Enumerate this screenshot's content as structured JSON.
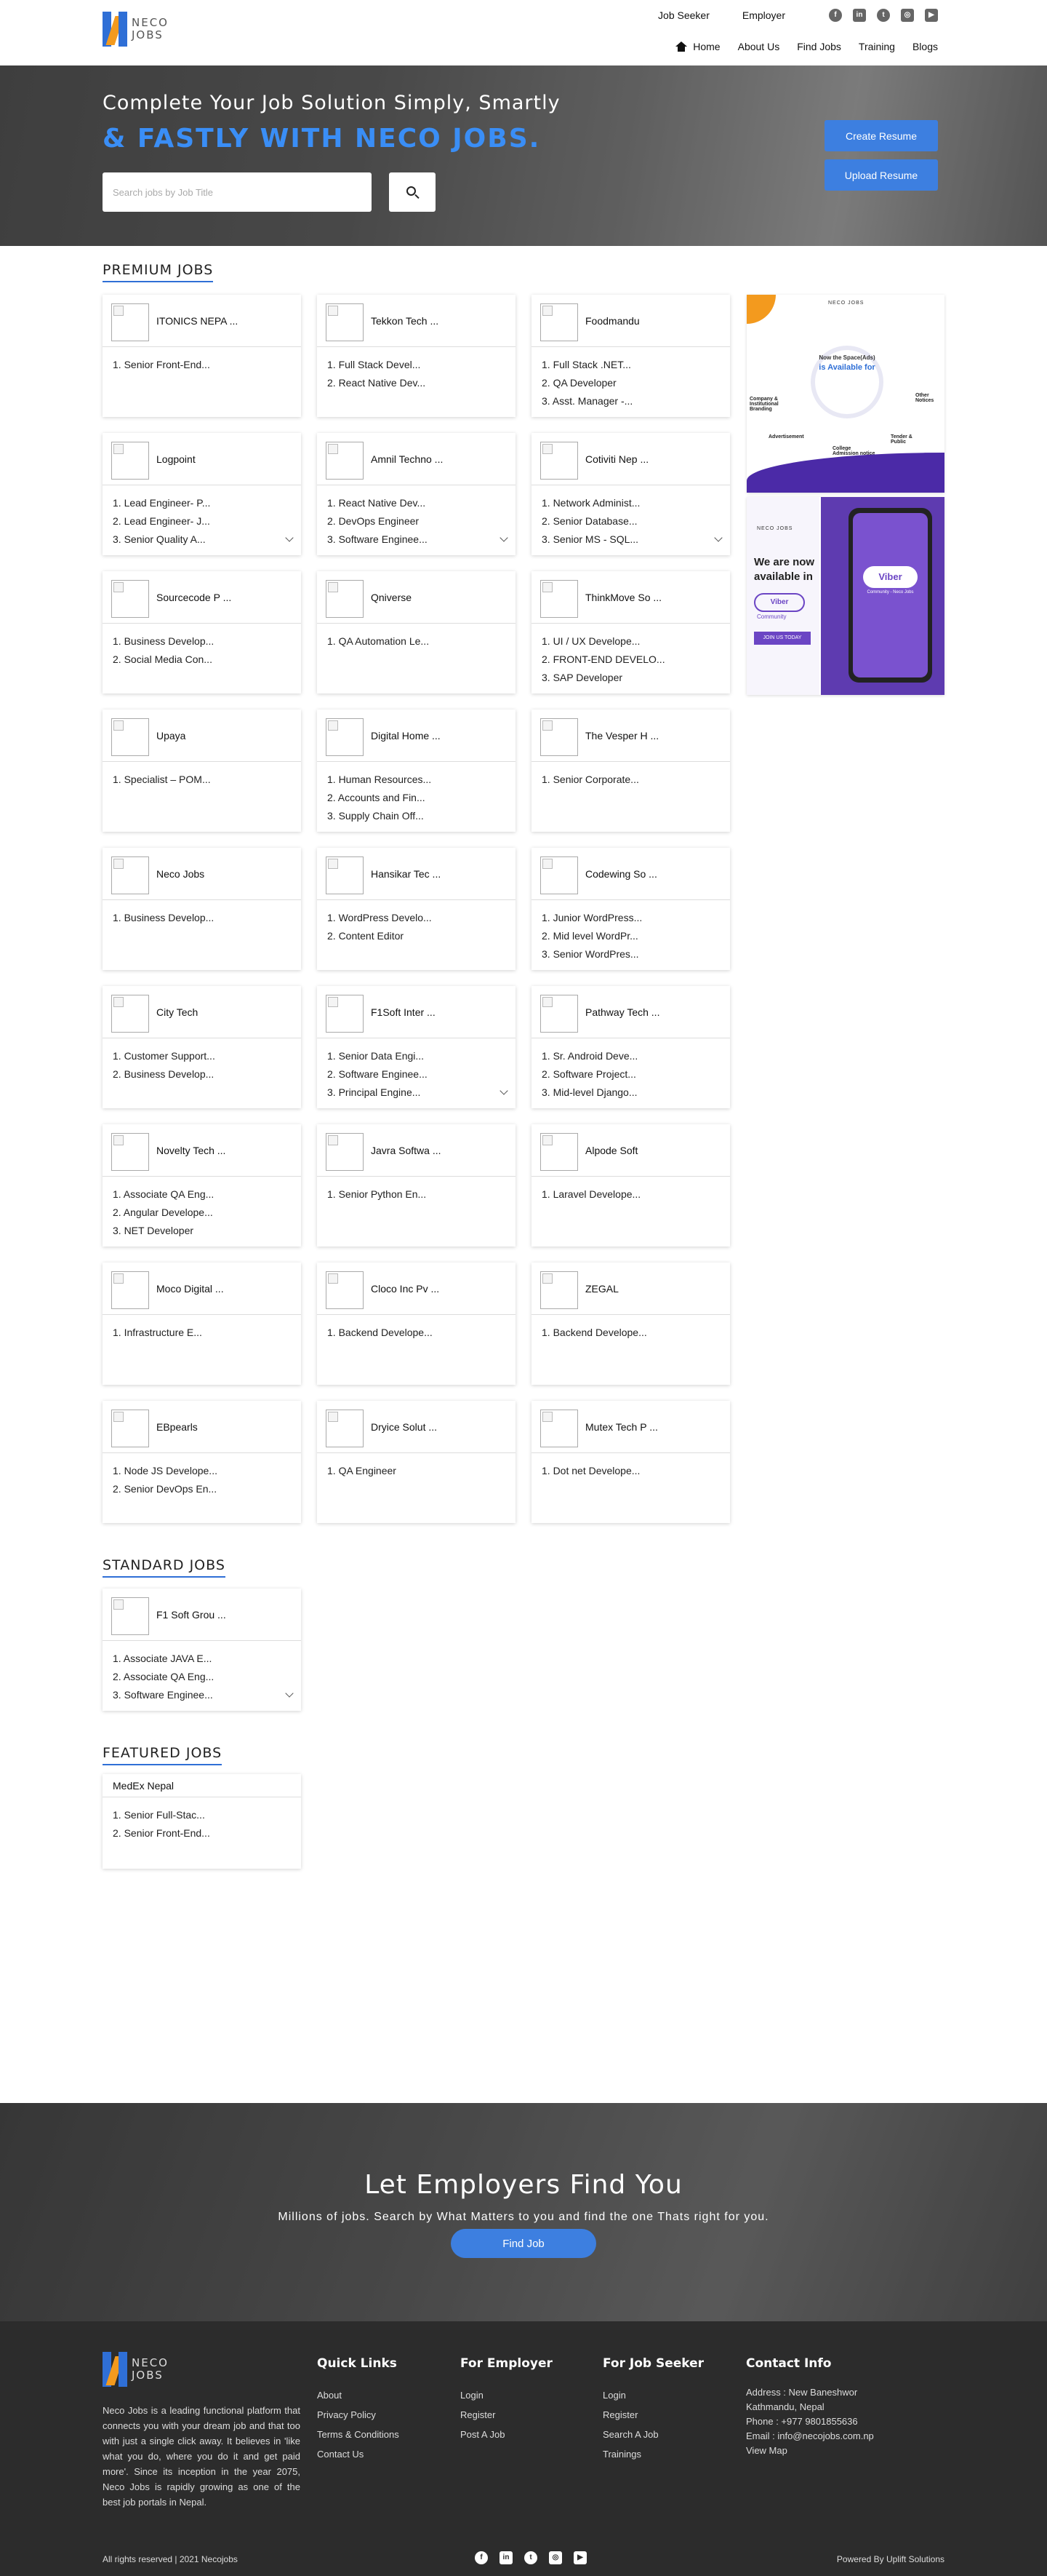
{
  "header": {
    "logo_text_line1": "NECO",
    "logo_text_line2": "JOBS",
    "top_links": [
      "Job Seeker",
      "Employer"
    ],
    "social_icons": [
      "facebook-icon",
      "linkedin-icon",
      "twitter-icon",
      "instagram-icon",
      "youtube-icon"
    ],
    "nav": [
      "Home",
      "About Us",
      "Find Jobs",
      "Training",
      "Blogs"
    ]
  },
  "hero": {
    "line1": "Complete Your Job Solution Simply, Smartly",
    "line2": "& FASTLY WITH NECO JOBS.",
    "search_placeholder": "Search jobs by Job Title",
    "create_resume": "Create Resume",
    "upload_resume": "Upload Resume"
  },
  "premium": {
    "title": "PREMIUM JOBS",
    "cards": [
      {
        "company": "ITONICS NEPA ...",
        "jobs": [
          "1. Senior Front-End..."
        ]
      },
      {
        "company": "Tekkon Tech ...",
        "jobs": [
          "1. Full Stack Devel...",
          "2. React Native Dev..."
        ]
      },
      {
        "company": "Foodmandu",
        "jobs": [
          "1. Full Stack .NET...",
          "2. QA Developer",
          "3. Asst. Manager -..."
        ]
      },
      {
        "company": "Logpoint",
        "jobs": [
          "1. Lead Engineer- P...",
          "2. Lead Engineer- J...",
          "3. Senior Quality A..."
        ],
        "expand": true
      },
      {
        "company": "Amnil Techno ...",
        "jobs": [
          "1. React Native Dev...",
          "2. DevOps Engineer",
          "3. Software Enginee..."
        ],
        "expand": true
      },
      {
        "company": "Cotiviti Nep ...",
        "jobs": [
          "1. Network Administ...",
          "2. Senior Database...",
          "3. Senior MS - SQL..."
        ],
        "expand": true
      },
      {
        "company": "Sourcecode P ...",
        "jobs": [
          "1. Business Develop...",
          "2. Social Media Con..."
        ]
      },
      {
        "company": "Qniverse",
        "jobs": [
          "1. QA Automation Le..."
        ]
      },
      {
        "company": "ThinkMove So ...",
        "jobs": [
          "1. UI / UX Develope...",
          "2. FRONT-END DEVELO...",
          "3. SAP Developer"
        ]
      },
      {
        "company": "Upaya",
        "jobs": [
          "1. Specialist – POM..."
        ]
      },
      {
        "company": "Digital Home ...",
        "jobs": [
          "1. Human Resources...",
          "2. Accounts and Fin...",
          "3. Supply Chain Off..."
        ]
      },
      {
        "company": "The Vesper H ...",
        "jobs": [
          "1. Senior Corporate..."
        ]
      },
      {
        "company": "Neco Jobs",
        "jobs": [
          "1. Business Develop..."
        ]
      },
      {
        "company": "Hansikar Tec ...",
        "jobs": [
          "1. WordPress Develo...",
          "2. Content Editor"
        ]
      },
      {
        "company": "Codewing So ...",
        "jobs": [
          "1. Junior WordPress...",
          "2. Mid level WordPr...",
          "3. Senior WordPres..."
        ]
      },
      {
        "company": "City Tech",
        "jobs": [
          "1. Customer Support...",
          "2. Business Develop..."
        ]
      },
      {
        "company": "F1Soft Inter ...",
        "jobs": [
          "1. Senior Data Engi...",
          "2. Software Enginee...",
          "3. Principal Engine..."
        ],
        "expand": true
      },
      {
        "company": "Pathway Tech ...",
        "jobs": [
          "1. Sr. Android Deve...",
          "2. Software Project...",
          "3. Mid-level Django..."
        ]
      },
      {
        "company": "Novelty Tech ...",
        "jobs": [
          "1. Associate QA Eng...",
          "2. Angular Develope...",
          "3. NET Developer"
        ]
      },
      {
        "company": "Javra Softwa ...",
        "jobs": [
          "1. Senior Python En..."
        ]
      },
      {
        "company": "Alpode Soft",
        "jobs": [
          "1. Laravel Develope..."
        ]
      },
      {
        "company": "Moco Digital ...",
        "jobs": [
          "1. Infrastructure E..."
        ]
      },
      {
        "company": "Cloco Inc Pv ...",
        "jobs": [
          "1. Backend Develope..."
        ]
      },
      {
        "company": "ZEGAL",
        "jobs": [
          "1. Backend Develope..."
        ]
      },
      {
        "company": "EBpearls",
        "jobs": [
          "1. Node JS Develope...",
          "2. Senior DevOps En..."
        ]
      },
      {
        "company": "Dryice Solut ...",
        "jobs": [
          "1. QA Engineer"
        ]
      },
      {
        "company": "Mutex Tech P ...",
        "jobs": [
          "1. Dot net Develope..."
        ]
      }
    ]
  },
  "ads": {
    "ad1": {
      "brand": "NECO JOBS",
      "line1": "Now the Space(Ads)",
      "line2": "is Available for",
      "labels": [
        "Company & Institutional Branding",
        "Advertisement",
        "College Admission notice",
        "Tender & Public",
        "Other Notices"
      ]
    },
    "ad2": {
      "brand": "NECO JOBS",
      "headline_line1": "We are now",
      "headline_line2": "available in",
      "pill": "Viber",
      "pill_sub": "Community",
      "join": "JOIN US TODAY",
      "screen_pill": "Viber",
      "screen_sub": "Community - Neco Jobs"
    }
  },
  "standard": {
    "title": "STANDARD JOBS",
    "cards": [
      {
        "company": "F1 Soft Grou ...",
        "jobs": [
          "1. Associate JAVA E...",
          "2. Associate QA Eng...",
          "3. Software Enginee..."
        ],
        "expand": true
      }
    ]
  },
  "featured": {
    "title": "FEATURED JOBS",
    "card": {
      "company": "MedEx Nepal",
      "jobs": [
        "1. Senior Full-Stac...",
        "2. Senior Front-End..."
      ]
    }
  },
  "cta": {
    "title": "Let Employers Find You",
    "subtitle": "Millions of jobs. Search by What Matters to you and find the one Thats right for you.",
    "button": "Find Job"
  },
  "footer": {
    "about": "Neco Jobs is a leading functional platform that connects you with your dream job and that too with just a single click away. It believes in 'like what you do, where you do it and get paid more'. Since its inception in the year 2075, Neco Jobs is rapidly growing as one of the best job portals in Nepal.",
    "quick_links_title": "Quick Links",
    "quick_links": [
      "About",
      "Privacy Policy",
      "Terms & Conditions",
      "Contact Us"
    ],
    "employer_title": "For Employer",
    "employer_links": [
      "Login",
      "Register",
      "Post A Job"
    ],
    "seeker_title": "For Job Seeker",
    "seeker_links": [
      "Login",
      "Register",
      "Search A Job",
      "Trainings"
    ],
    "contact_title": "Contact Info",
    "address": "Address : New Baneshwor Kathmandu, Nepal",
    "phone": "Phone : +977 9801855636",
    "email": "Email : info@necojobs.com.np",
    "view_map": "View Map",
    "copyright": "All rights reserved | 2021 Necojobs",
    "powered": "Powered By Uplift Solutions"
  }
}
